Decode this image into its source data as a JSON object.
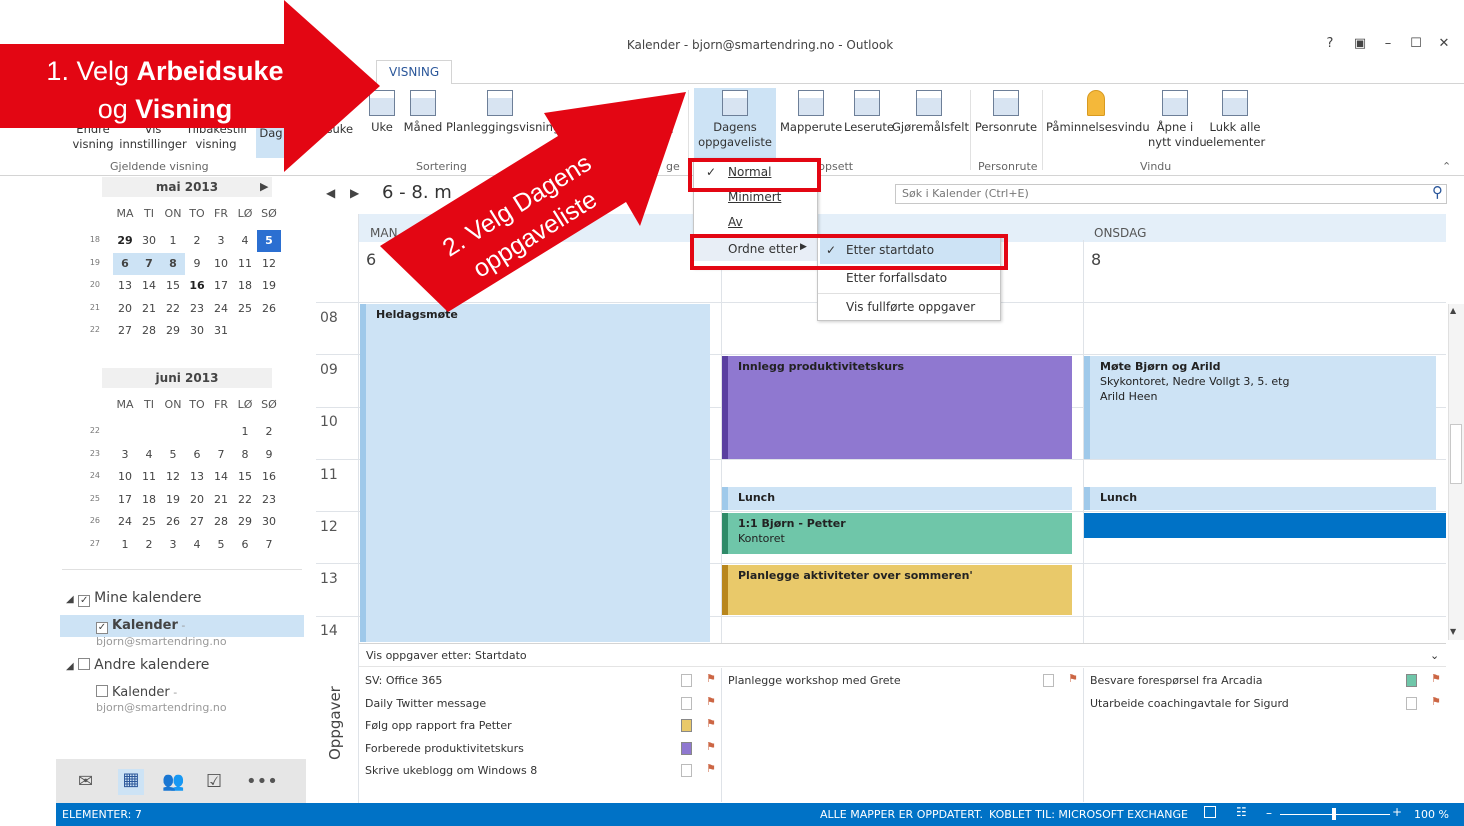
{
  "window": {
    "title": "Kalender - bjorn@smartendring.no - Outlook",
    "help": "?",
    "controls": [
      "?",
      "▣",
      "–",
      "☐",
      "✕"
    ]
  },
  "tabs": {
    "partial_left": "E",
    "active": "VISNING"
  },
  "ribbon": {
    "buttons": {
      "endre_visning": "Endre\nvisning",
      "vis_innstillinger": "Vis\ninnstillinger",
      "tilbakestill": "Tilbakestill\nvisning",
      "dag": "Dag",
      "arbeidsuke": "eidsuke",
      "uke": "Uke",
      "maned": "Måned",
      "planlegging": "Planleggingsvisning",
      "dagens": "Dagens\noppgaveliste",
      "mapperute": "Mapperute",
      "leserute": "Leserute",
      "gjoremalsfelt": "Gjøremålsfelt",
      "personrute": "Personrute",
      "paminnelsesvindu": "Påminnelsesvindu",
      "apne_nytt": "Åpne i\nnytt vindu",
      "lukk_alle": "Lukk alle\nelementer",
      "partial_e": "e"
    },
    "groups": {
      "gjeldende": "Gjeldende visning",
      "sortering": "Sortering",
      "oppsett": "ppsett",
      "personrute": "Personrute",
      "vindu": "Vindu",
      "partial": "ge"
    }
  },
  "minical": {
    "may": {
      "title": "mai 2013",
      "days": [
        "MA",
        "TI",
        "ON",
        "TO",
        "FR",
        "LØ",
        "SØ"
      ],
      "rows": [
        {
          "w": "18",
          "d": [
            "29",
            "30",
            "1",
            "2",
            "3",
            "4",
            "5"
          ]
        },
        {
          "w": "19",
          "d": [
            "6",
            "7",
            "8",
            "9",
            "10",
            "11",
            "12"
          ]
        },
        {
          "w": "20",
          "d": [
            "13",
            "14",
            "15",
            "16",
            "17",
            "18",
            "19"
          ]
        },
        {
          "w": "21",
          "d": [
            "20",
            "21",
            "22",
            "23",
            "24",
            "25",
            "26"
          ]
        },
        {
          "w": "22",
          "d": [
            "27",
            "28",
            "29",
            "30",
            "31",
            "",
            ""
          ]
        }
      ]
    },
    "june": {
      "title": "juni 2013",
      "days": [
        "MA",
        "TI",
        "ON",
        "TO",
        "FR",
        "LØ",
        "SØ"
      ],
      "rows": [
        {
          "w": "22",
          "d": [
            "",
            "",
            "",
            "",
            "",
            "1",
            "2"
          ]
        },
        {
          "w": "23",
          "d": [
            "3",
            "4",
            "5",
            "6",
            "7",
            "8",
            "9"
          ]
        },
        {
          "w": "24",
          "d": [
            "10",
            "11",
            "12",
            "13",
            "14",
            "15",
            "16"
          ]
        },
        {
          "w": "25",
          "d": [
            "17",
            "18",
            "19",
            "20",
            "21",
            "22",
            "23"
          ]
        },
        {
          "w": "26",
          "d": [
            "24",
            "25",
            "26",
            "27",
            "28",
            "29",
            "30"
          ]
        },
        {
          "w": "27",
          "d": [
            "1",
            "2",
            "3",
            "4",
            "5",
            "6",
            "7"
          ]
        }
      ]
    }
  },
  "calendars": {
    "mine": "Mine kalendere",
    "mine_item": "Kalender",
    "mine_item_email": " - bjorn@smartendring.no",
    "andre": "Andre kalendere",
    "andre_item": "Kalender",
    "andre_item_email": " - bjorn@smartendring.no"
  },
  "calendar": {
    "range": "6 - 8. m",
    "search_placeholder": "Søk i Kalender (Ctrl+E)",
    "days": [
      {
        "name": "MAN",
        "num": "6"
      },
      {
        "name": "",
        "num": ""
      },
      {
        "name": "ONSDAG",
        "num": "8"
      }
    ],
    "hours": [
      "08",
      "09",
      "10",
      "11",
      "12",
      "13",
      "14"
    ]
  },
  "appointments": {
    "heldag": "Heldagsmøte",
    "innlegg": "Innlegg produktivitetskurs",
    "lunch1": "Lunch",
    "onetoone": "1:1 Bjørn - Petter",
    "onetoone_loc": "Kontoret",
    "planlegge": "Planlegge aktiviteter over sommeren'",
    "mote": "Møte Bjørn og Arild",
    "mote_loc": "Skykontoret, Nedre Vollgt 3, 5. etg",
    "mote_who": "Arild Heen",
    "lunch2": "Lunch"
  },
  "tasks": {
    "header": "Vis oppgaver etter: Startdato",
    "pane_label": "Oppgaver",
    "col1": [
      "SV: Office 365",
      "Daily Twitter message",
      "Følg opp rapport fra Petter",
      "Forberede produktivitetskurs",
      "Skrive ukeblogg om Windows 8"
    ],
    "col2": [
      "Planlegge workshop med Grete"
    ],
    "col3": [
      "Besvare forespørsel fra Arcadia",
      "Utarbeide coachingavtale for Sigurd"
    ]
  },
  "dropdown": {
    "normal": "Normal",
    "minimert": "Minimert",
    "av": "Av",
    "ordne": "Ordne etter",
    "startdato": "Etter startdato",
    "forfallsdato": "Etter forfallsdato",
    "fullforte": "Vis fullførte oppgaver"
  },
  "status": {
    "elementer": "ELEMENTER: 7",
    "oppdatert": "ALLE MAPPER ER OPPDATERT.",
    "koblet": "KOBLET TIL: MICROSOFT EXCHANGE",
    "zoom": "100 %"
  },
  "callouts": {
    "one_a": "1. Velg ",
    "one_b": "Arbeidsuke",
    "one_c": "og ",
    "one_d": "Visning",
    "two_a": "2. Velg Dagens",
    "two_b": "oppgaveliste"
  },
  "colors": {
    "accent": "#0072c6",
    "purple": "#8f78d0",
    "green": "#6fc6a9",
    "yellow": "#e9c96a",
    "lightblue": "#cde3f5",
    "red": "#e30613"
  }
}
